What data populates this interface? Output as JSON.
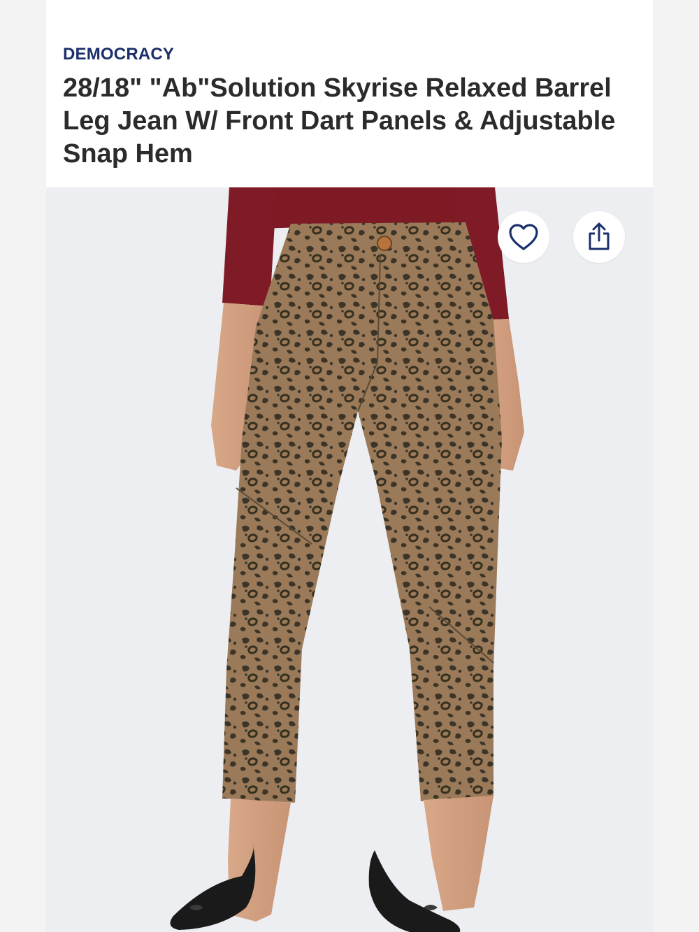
{
  "product": {
    "brand": "DEMOCRACY",
    "title": "28/18\" \"Ab\"Solution Skyrise Relaxed Barrel Leg Jean W/ Front Dart Panels & Adjustable Snap Hem"
  },
  "icons": {
    "favorite": "heart-icon",
    "share": "share-icon"
  },
  "colors": {
    "brand_text": "#1a2f6b",
    "title_text": "#2b2b2b",
    "icon_accent": "#1a2f6b"
  }
}
